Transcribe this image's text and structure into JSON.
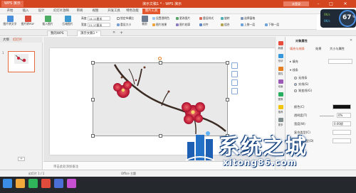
{
  "titlebar": {
    "app_label": "WPS 演示",
    "doc_title": "演示文稿1 * - WPS 演示",
    "login_label": "未登录"
  },
  "ribbon_tabs": [
    "开始",
    "插入",
    "设计",
    "幻灯片放映",
    "审阅",
    "视图",
    "开发工具",
    "特色功能",
    "图片工具"
  ],
  "active_tab": "图片工具",
  "ribbon": {
    "buttons": [
      "图片转文字",
      "图片转PDF",
      "插入图片",
      "压缩图片"
    ],
    "height_label": "高度",
    "height_value": "14.11厘米",
    "width_label": "宽度",
    "width_value": "21.17厘米",
    "lock_ratio": "锁定纵横比",
    "reset_size": "重设大小",
    "crop": "裁剪",
    "reset_picture": "设置透明色",
    "picture_effect": "图片效果",
    "change_picture": "更改图片",
    "picture_outline": "图片轮廓",
    "reset_style": "重设样式",
    "align": "对齐",
    "rotate": "旋转",
    "combine": "组合",
    "selection_pane": "选择窗格",
    "bring_forward": "上移一层",
    "send_backward": "下移一层"
  },
  "speed_widget": {
    "percent": "67",
    "unit": "%",
    "up": "0K/s",
    "down": "0K/s"
  },
  "doc_tabs": [
    "我的WPS",
    "演示文稿1 *"
  ],
  "left_panel": {
    "tabs": [
      "大纲",
      "幻灯片"
    ],
    "slide_number": "1"
  },
  "notes_placeholder": "单击此处添加备注",
  "status": {
    "slide_info": "幻灯片 1 / 1",
    "theme": "Office 主题"
  },
  "right_strip": [
    "新建",
    "形状",
    "属性",
    "动画",
    "图像",
    "推荐",
    "更多"
  ],
  "props_panel": {
    "title": "对象属性",
    "tabs": [
      "填充与线条",
      "效果",
      "大小与属性"
    ],
    "fill_label": "填充",
    "line_label": "线条",
    "line_options": [
      "无线条",
      "实线(S)",
      "渐变线(G)"
    ],
    "color_label": "颜色(C)",
    "transparency_label": "透明度(T)",
    "transparency_value": "0%",
    "width_label": "宽度(W)",
    "width_value": "0.00磅",
    "compound_label": "复合类型(C)",
    "dash_label": "短划线类型(D)"
  },
  "watermark": {
    "title": "系统之城",
    "url": "xitong86.com"
  },
  "colors": {
    "accent": "#d4461f",
    "blossom": "#c8233d",
    "branch": "#3a2a22"
  },
  "icons": [
    "close-icon",
    "minimize-icon",
    "maximize-icon",
    "plus-icon",
    "zoom-icon"
  ]
}
